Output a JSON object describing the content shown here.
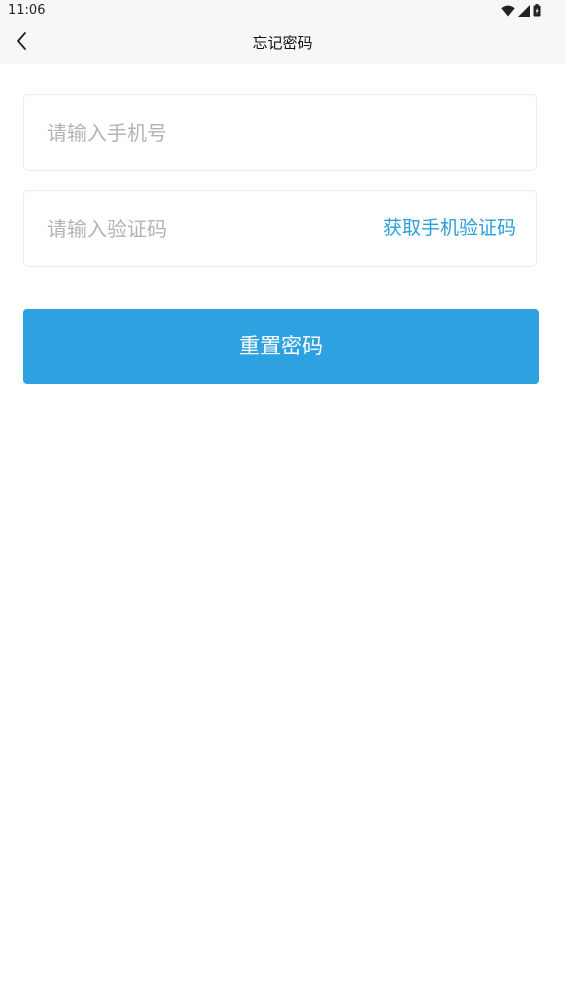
{
  "status_bar": {
    "time": "11:06",
    "icons": [
      "wifi-icon",
      "signal-icon",
      "battery-icon"
    ]
  },
  "nav": {
    "title": "忘记密码",
    "back_icon": "chevron-left-icon"
  },
  "form": {
    "phone_placeholder": "请输入手机号",
    "phone_value": "",
    "code_placeholder": "请输入验证码",
    "code_value": "",
    "get_code_label": "获取手机验证码",
    "submit_label": "重置密码"
  },
  "colors": {
    "accent": "#2ea1e0",
    "link": "#2a9fd8",
    "placeholder": "#b3b3b3",
    "header_bg": "#f7f7f7"
  }
}
